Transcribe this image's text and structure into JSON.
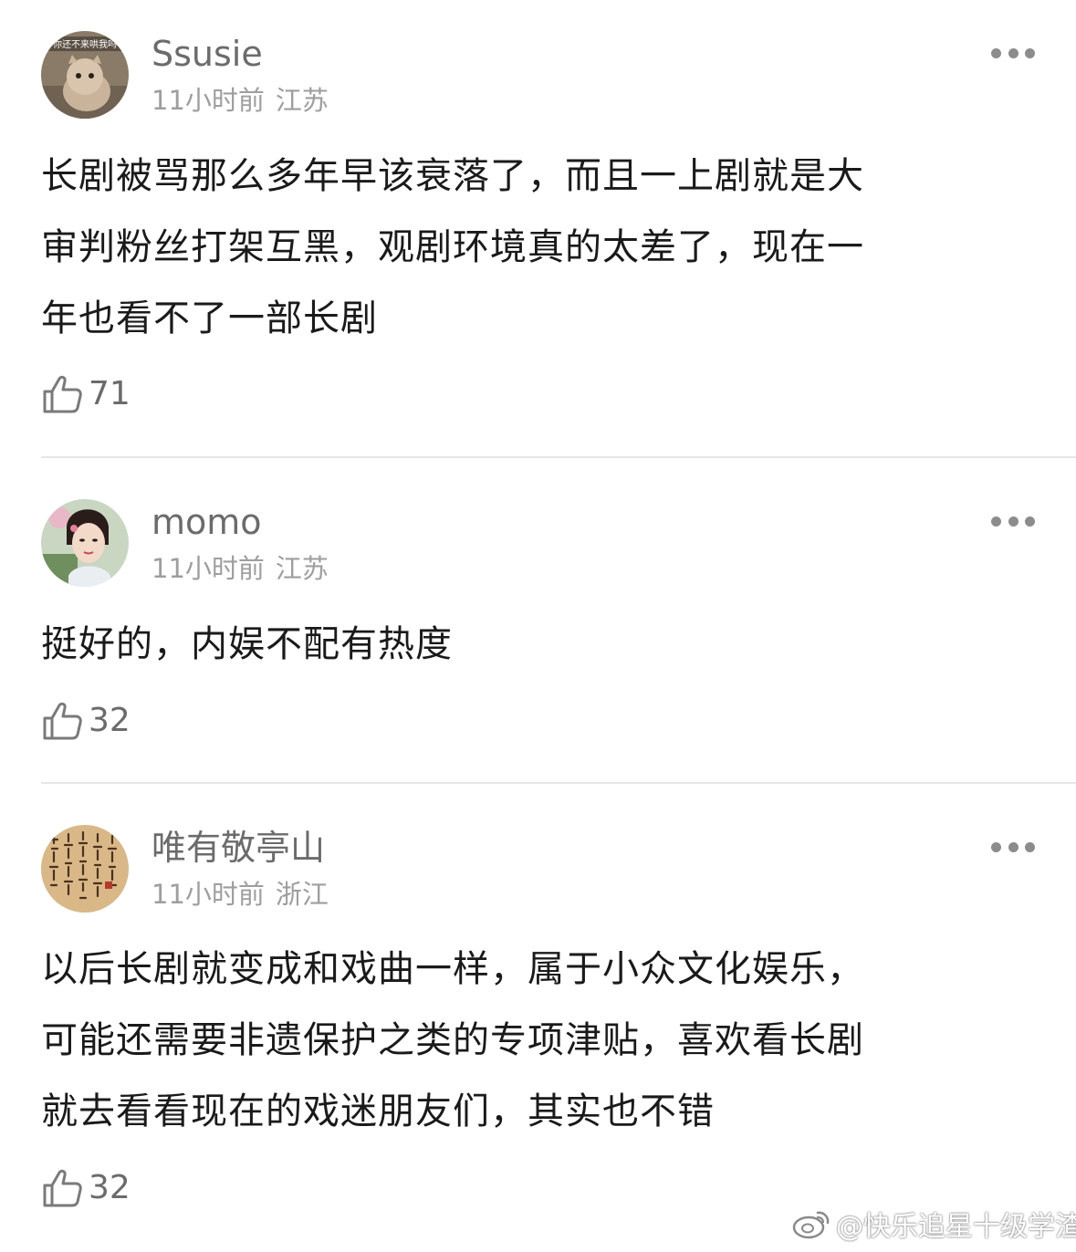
{
  "comments": [
    {
      "username": "Ssusie",
      "avatar_caption": "你还不来哄我吗",
      "time": "11小时前",
      "location": "江苏",
      "lines": [
        "长剧被骂那么多年早该衰落了，而且一上剧就是大",
        "审判粉丝打架互黑，观剧环境真的太差了，现在一",
        "年也看不了一部长剧"
      ],
      "likes": "71",
      "more_icon": "more-dots-icon",
      "like_icon": "thumbs-up-icon"
    },
    {
      "username": "momo",
      "time": "11小时前",
      "location": "江苏",
      "lines": [
        "挺好的，内娱不配有热度"
      ],
      "likes": "32",
      "more_icon": "more-dots-icon",
      "like_icon": "thumbs-up-icon"
    },
    {
      "username": "唯有敬亭山",
      "time": "11小时前",
      "location": "浙江",
      "lines": [
        "以后长剧就变成和戏曲一样，属于小众文化娱乐，",
        "可能还需要非遗保护之类的专项津贴，喜欢看长剧",
        "就去看看现在的戏迷朋友们，其实也不错"
      ],
      "likes": "32",
      "more_icon": "more-dots-icon",
      "like_icon": "thumbs-up-icon"
    }
  ],
  "watermark": {
    "text": "@快乐追星十级学渣",
    "icon": "weibo-logo-icon"
  },
  "colors": {
    "username": "#6b6b6b",
    "meta": "#9e9e9e",
    "body_text": "#1a1a1a",
    "divider": "#e6e6e6",
    "icon": "#8c8c8c"
  }
}
